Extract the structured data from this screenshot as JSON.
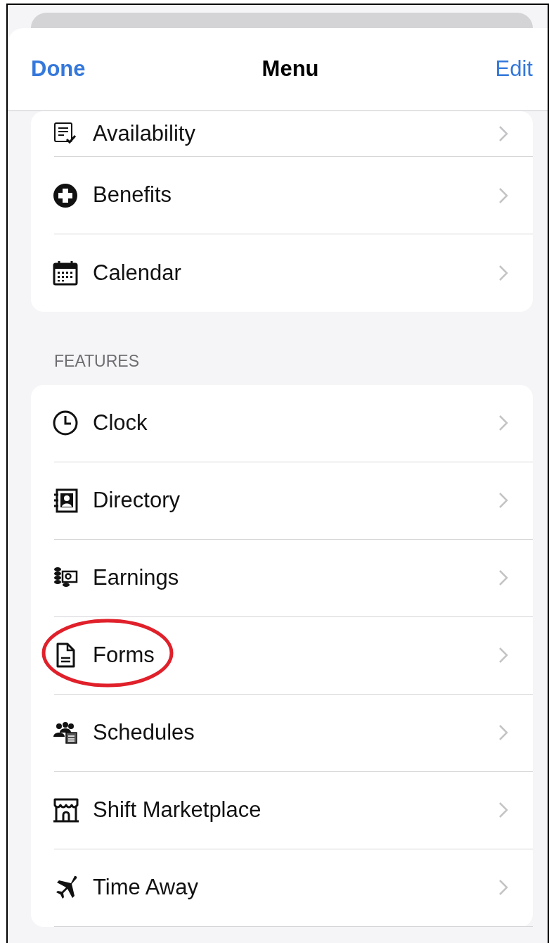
{
  "header": {
    "left_button": "Done",
    "title": "Menu",
    "right_button": "Edit"
  },
  "sections": [
    {
      "items": [
        {
          "label": "Availability",
          "annotated": false
        },
        {
          "label": "Benefits",
          "annotated": false
        },
        {
          "label": "Calendar",
          "annotated": false
        }
      ]
    },
    {
      "title": "FEATURES",
      "items": [
        {
          "label": "Clock",
          "annotated": false
        },
        {
          "label": "Directory",
          "annotated": false
        },
        {
          "label": "Earnings",
          "annotated": false
        },
        {
          "label": "Forms",
          "annotated": true
        },
        {
          "label": "Schedules",
          "annotated": false
        },
        {
          "label": "Shift Marketplace",
          "annotated": false
        },
        {
          "label": "Time Away",
          "annotated": false
        }
      ]
    }
  ]
}
